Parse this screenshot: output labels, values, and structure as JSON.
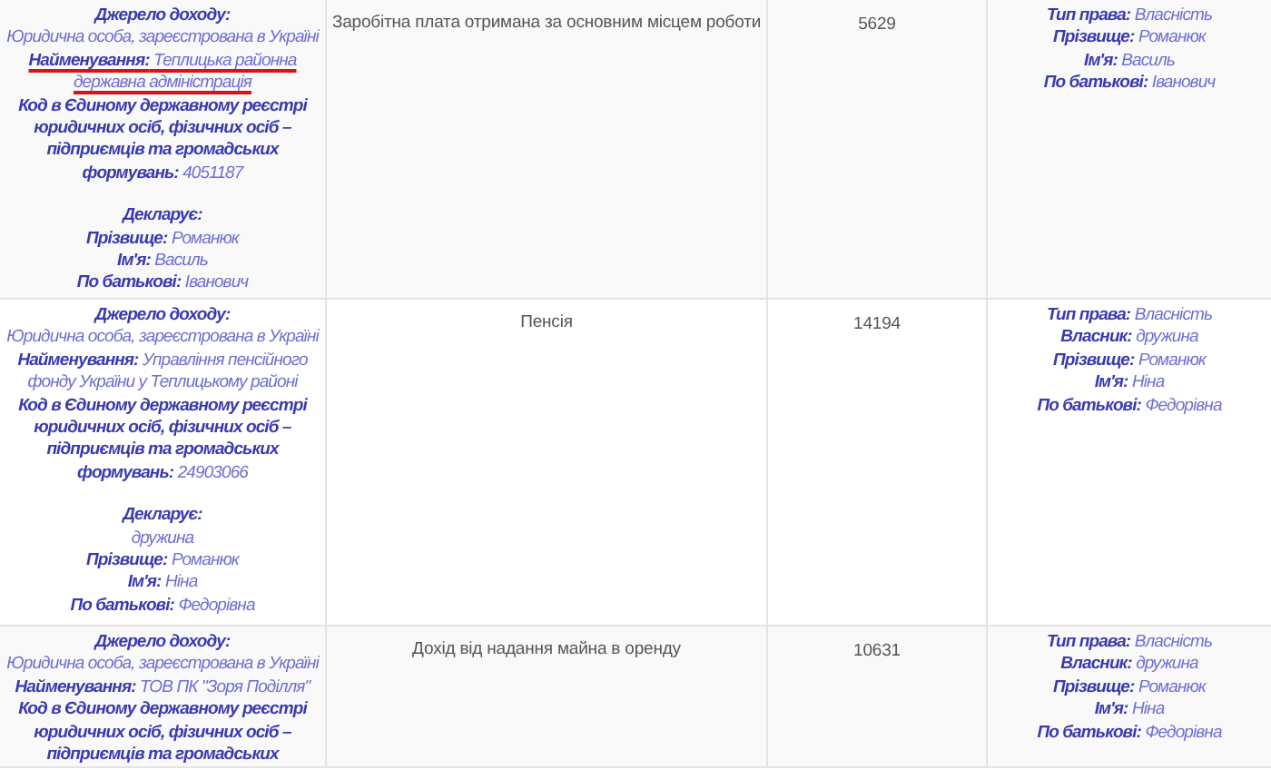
{
  "rows": [
    {
      "source": [
        {
          "lines": [
            {
              "label": "Джерело доходу:"
            },
            {
              "value": "Юридична особа, зареєстрована в Україні"
            },
            {
              "label": "Найменування:",
              "value": "Теплицька районна державна адміністрація",
              "marked": true
            },
            {
              "label": "Код в Єдиному державному реєстрі юридичних осіб, фізичних осіб – підприємців та громадських формувань:",
              "value": "4051187"
            }
          ]
        },
        {
          "lines": [
            {
              "label": "Декларує:"
            },
            {
              "label": "Прізвище:",
              "value": "Романюк"
            },
            {
              "label": "Ім'я:",
              "value": "Василь"
            },
            {
              "label": "По батькові:",
              "value": "Іванович"
            }
          ]
        }
      ],
      "income_type": "Заробітна плата отримана за основним місцем роботи",
      "amount": "5629",
      "rights": [
        {
          "label": "Тип права:",
          "value": "Власність"
        },
        {
          "label": "Прізвище:",
          "value": "Романюк"
        },
        {
          "label": "Ім'я:",
          "value": "Василь"
        },
        {
          "label": "По батькові:",
          "value": "Іванович"
        }
      ]
    },
    {
      "source": [
        {
          "lines": [
            {
              "label": "Джерело доходу:"
            },
            {
              "value": "Юридична особа, зареєстрована в Україні"
            },
            {
              "label": "Найменування:",
              "value": "Управління пенсійного фонду України у Теплицькому районі"
            },
            {
              "label": "Код в Єдиному державному реєстрі юридичних осіб, фізичних осіб – підприємців та громадських формувань:",
              "value": "24903066"
            }
          ]
        },
        {
          "lines": [
            {
              "label": "Декларує:"
            },
            {
              "value": "дружина"
            },
            {
              "label": "Прізвище:",
              "value": "Романюк"
            },
            {
              "label": "Ім'я:",
              "value": "Ніна"
            },
            {
              "label": "По батькові:",
              "value": "Федорівна"
            }
          ]
        }
      ],
      "income_type": "Пенсія",
      "amount": "14194",
      "rights": [
        {
          "label": "Тип права:",
          "value": "Власність"
        },
        {
          "label": "Власник:",
          "value": "дружина"
        },
        {
          "label": "Прізвище:",
          "value": "Романюк"
        },
        {
          "label": "Ім'я:",
          "value": "Ніна"
        },
        {
          "label": "По батькові:",
          "value": "Федорівна"
        }
      ]
    },
    {
      "source": [
        {
          "lines": [
            {
              "label": "Джерело доходу:"
            },
            {
              "value": "Юридична особа, зареєстрована в Україні"
            },
            {
              "label": "Найменування:",
              "value": "ТОВ ПК \"Зоря Поділля\""
            },
            {
              "label": "Код в Єдиному державному реєстрі юридичних осіб, фізичних осіб – підприємців та громадських"
            }
          ]
        }
      ],
      "income_type": "Дохід від надання майна в оренду",
      "amount": "10631",
      "rights": [
        {
          "label": "Тип права:",
          "value": "Власність"
        },
        {
          "label": "Власник:",
          "value": "дружина"
        },
        {
          "label": "Прізвище:",
          "value": "Романюк"
        },
        {
          "label": "Ім'я:",
          "value": "Ніна"
        },
        {
          "label": "По батькові:",
          "value": "Федорівна"
        }
      ]
    }
  ]
}
